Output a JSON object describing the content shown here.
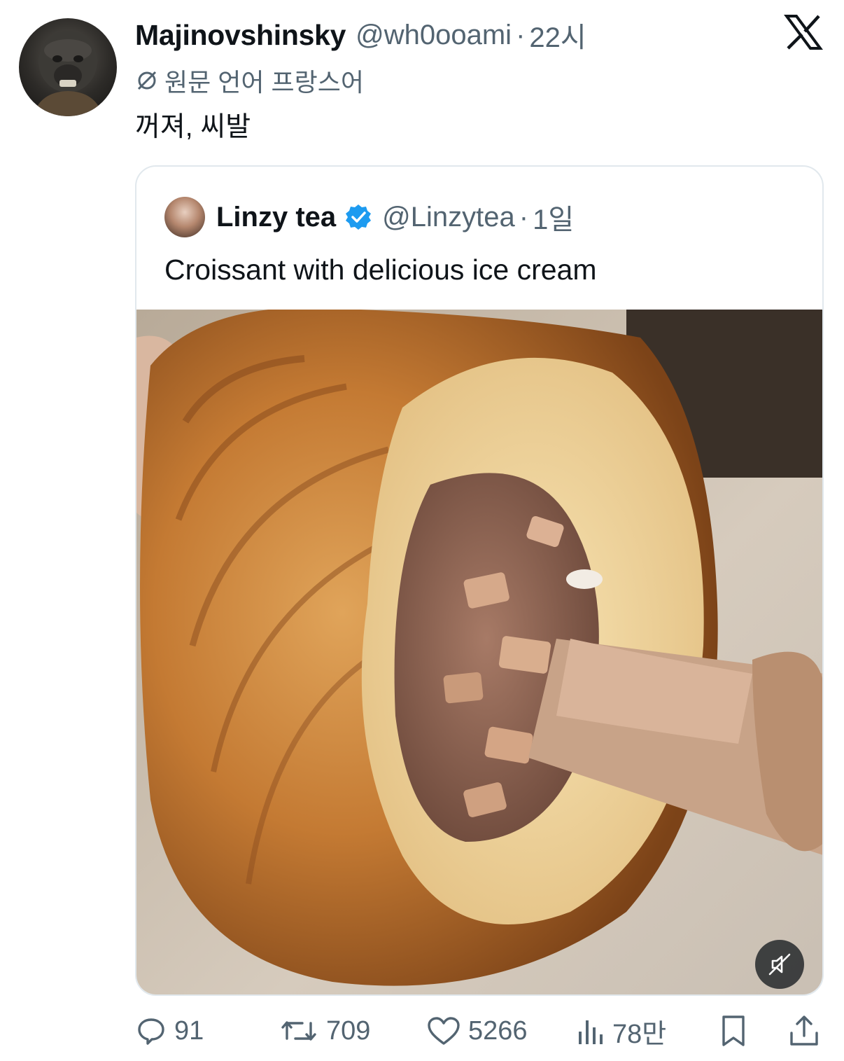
{
  "tweet": {
    "display_name": "Majinovshinsky",
    "handle": "@wh0ooami",
    "separator": "·",
    "time": "22시",
    "translation_note": "원문 언어 프랑스어",
    "text": "꺼져, 씨발"
  },
  "quote": {
    "display_name": "Linzy tea",
    "handle": "@Linzytea",
    "separator": "·",
    "time": "1일",
    "text": "Croissant with delicious ice cream"
  },
  "actions": {
    "replies": "91",
    "retweets": "709",
    "likes": "5266",
    "views": "78만"
  },
  "icons": {
    "brand": "x-logo-icon",
    "translate": "translate-icon",
    "verified": "verified-badge-icon",
    "mute": "mute-icon",
    "reply": "reply-icon",
    "retweet": "retweet-icon",
    "like": "heart-icon",
    "views": "views-icon",
    "bookmark": "bookmark-icon",
    "share": "share-icon"
  },
  "colors": {
    "text": "#0f1419",
    "secondary": "#536471",
    "verified": "#1d9bf0",
    "border": "#e1e8ed"
  }
}
